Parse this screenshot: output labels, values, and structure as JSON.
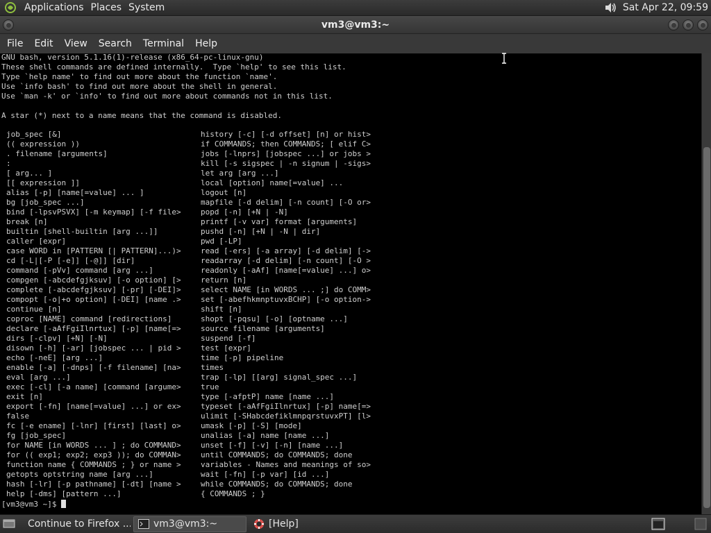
{
  "top_panel": {
    "menus": [
      "Applications",
      "Places",
      "System"
    ],
    "clock": "Sat Apr 22, 09:59"
  },
  "window": {
    "title": "vm3@vm3:~"
  },
  "menubar": {
    "items": [
      "File",
      "Edit",
      "View",
      "Search",
      "Terminal",
      "Help"
    ]
  },
  "terminal": {
    "intro": "GNU bash, version 5.1.16(1)-release (x86_64-pc-linux-gnu)\nThese shell commands are defined internally.  Type `help' to see this list.\nType `help name' to find out more about the function `name'.\nUse `info bash' to find out more about the shell in general.\nUse `man -k' or `info' to find out more about commands not in this list.\n\nA star (*) next to a name means that the command is disabled.",
    "left_column": "job_spec [&]\n(( expression ))\n. filename [arguments]\n:\n[ arg... ]\n[[ expression ]]\nalias [-p] [name[=value] ... ]\nbg [job_spec ...]\nbind [-lpsvPSVX] [-m keymap] [-f file>\nbreak [n]\nbuiltin [shell-builtin [arg ...]]\ncaller [expr]\ncase WORD in [PATTERN [| PATTERN]...)>\ncd [-L|[-P [-e]] [-@]] [dir]\ncommand [-pVv] command [arg ...]\ncompgen [-abcdefgjksuv] [-o option] [>\ncomplete [-abcdefgjksuv] [-pr] [-DEI]>\ncompopt [-o|+o option] [-DEI] [name .>\ncontinue [n]\ncoproc [NAME] command [redirections]\ndeclare [-aAfFgiIlnrtux] [-p] [name[=>\ndirs [-clpv] [+N] [-N]\ndisown [-h] [-ar] [jobspec ... | pid >\necho [-neE] [arg ...]\nenable [-a] [-dnps] [-f filename] [na>\neval [arg ...]\nexec [-cl] [-a name] [command [argume>\nexit [n]\nexport [-fn] [name[=value] ...] or ex>\nfalse\nfc [-e ename] [-lnr] [first] [last] o>\nfg [job_spec]\nfor NAME [in WORDS ... ] ; do COMMAND>\nfor (( exp1; exp2; exp3 )); do COMMAN>\nfunction name { COMMANDS ; } or name >\ngetopts optstring name [arg ...]\nhash [-lr] [-p pathname] [-dt] [name >\nhelp [-dms] [pattern ...]",
    "right_column": "history [-c] [-d offset] [n] or hist>\nif COMMANDS; then COMMANDS; [ elif C>\njobs [-lnprs] [jobspec ...] or jobs >\nkill [-s sigspec | -n signum | -sigs>\nlet arg [arg ...]\nlocal [option] name[=value] ...\nlogout [n]\nmapfile [-d delim] [-n count] [-O or>\npopd [-n] [+N | -N]\nprintf [-v var] format [arguments]\npushd [-n] [+N | -N | dir]\npwd [-LP]\nread [-ers] [-a array] [-d delim] [->\nreadarray [-d delim] [-n count] [-O >\nreadonly [-aAf] [name[=value] ...] o>\nreturn [n]\nselect NAME [in WORDS ... ;] do COMM>\nset [-abefhkmnptuvxBCHP] [-o option->\nshift [n]\nshopt [-pqsu] [-o] [optname ...]\nsource filename [arguments]\nsuspend [-f]\ntest [expr]\ntime [-p] pipeline\ntimes\ntrap [-lp] [[arg] signal_spec ...]\ntrue\ntype [-afptP] name [name ...]\ntypeset [-aAfFgiIlnrtux] [-p] name[=>\nulimit [-SHabcdefiklmnpqrstuvxPT] [l>\numask [-p] [-S] [mode]\nunalias [-a] name [name ...]\nunset [-f] [-v] [-n] [name ...]\nuntil COMMANDS; do COMMANDS; done\nvariables - Names and meanings of so>\nwait [-fn] [-p var] [id ...]\nwhile COMMANDS; do COMMANDS; done\n{ COMMANDS ; }",
    "prompt": "[vm3@vm3 ~]$ "
  },
  "taskbar": {
    "tasks": [
      "Continue to Firefox ...",
      "vm3@vm3:~",
      "[Help]"
    ]
  },
  "colors": {
    "terminal_bg": "#000000",
    "terminal_fg": "#cfcfcf",
    "panel_bg": "#333333"
  }
}
